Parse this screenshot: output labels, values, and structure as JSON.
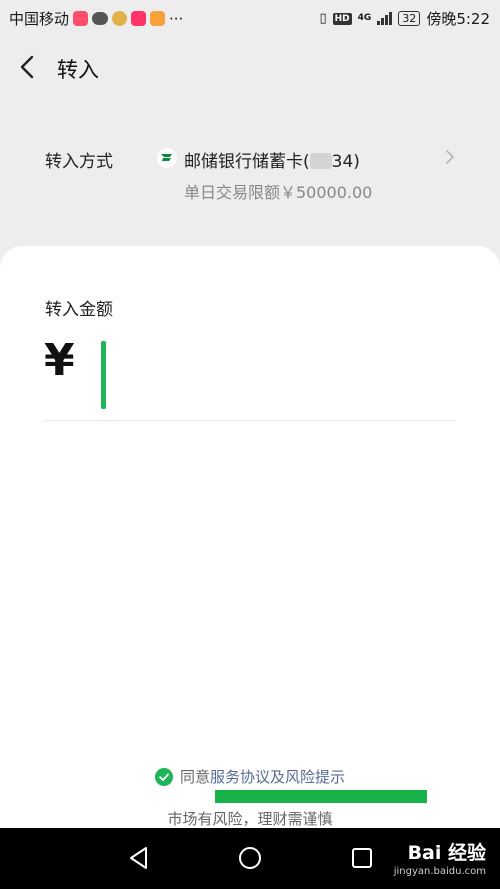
{
  "status_bar": {
    "carrier": "中国移动",
    "more": "···",
    "network": "4G",
    "hd": "HD",
    "battery": "32",
    "time": "傍晚5:22"
  },
  "header": {
    "title": "转入"
  },
  "transfer_method": {
    "label": "转入方式",
    "bank_name": "邮储银行储蓄卡(",
    "card_tail": "34)",
    "daily_limit": "单日交易限额￥50000.00"
  },
  "amount": {
    "label": "转入金额",
    "currency_symbol": "¥",
    "value": ""
  },
  "agreement": {
    "prefix": "同意",
    "link_text": "服务协议及风险提示"
  },
  "risk_note": "市场有风险，理财需谨慎",
  "watermark": {
    "brand": "Bai 经验",
    "url": "jingyan.baidu.com"
  },
  "colors": {
    "accent_green": "#1fb35a",
    "link_blue": "#576b95",
    "page_bg": "#ededed"
  },
  "icons": {
    "back": "chevron-left-icon",
    "forward": "chevron-right-icon",
    "agree": "check-circle-icon",
    "bank": "postal-bank-logo-icon"
  }
}
